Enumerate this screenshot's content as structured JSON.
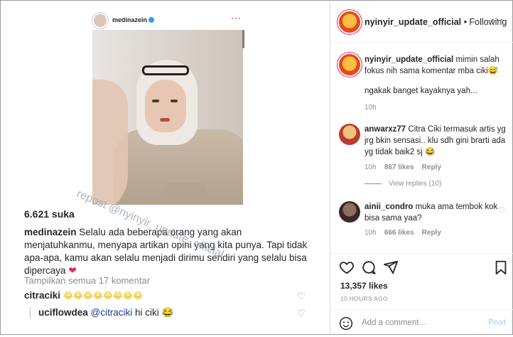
{
  "embedded_post": {
    "username": "medinazein",
    "likes": "6.621 suka",
    "caption_user": "medinazein",
    "caption_text": "Selalu ada beberapa orang yang akan menjatuhkanmu, menyapa artikan opini yang kita punya. Tapi tidak apa-apa, kamu akan selalu menjadi dirimu sendiri yang selalu bisa dipercaya",
    "view_comments": "Tampilkan semua 17 komentar",
    "comments": [
      {
        "user": "citraciki",
        "text": "😂😂😂😂😂😂😂😂"
      },
      {
        "user": "uciflowdea",
        "mention": "@citraciki",
        "text": "hi ciki 😂"
      }
    ],
    "watermark": "repost @nyinyir_update_official"
  },
  "sidebar": {
    "header": {
      "username": "nyinyir_update_official",
      "follow_status": "Following"
    },
    "comments": [
      {
        "user": "nyinyir_update_official",
        "text": "mimin salah fokus nih sama komentar mba ciki😅",
        "text2": "ngakak banget kayaknya yah...",
        "time": "10h"
      },
      {
        "user": "anwarxz77",
        "text": "Citra Ciki termasuk artis yg jrg bkin sensasi.. klu sdh gini brarti ada yg tidak baik2 sj 😂",
        "time": "10h",
        "likes": "867 likes",
        "reply": "Reply",
        "view_replies": "View replies (10)"
      },
      {
        "user": "ainii_condro",
        "text": "muka ama tembok kok bisa sama yaa?",
        "time": "10h",
        "likes": "666 likes",
        "reply": "Reply"
      }
    ],
    "likes": "13,357 likes",
    "time_ago": "10 HOURS AGO",
    "add_comment_placeholder": "Add a comment…",
    "post_button": "Post"
  },
  "colors": {
    "link_blue": "#3897f0",
    "post_disabled": "#b2dffc",
    "heart_red": "#e0245e"
  },
  "icons": [
    "heart-icon",
    "comment-icon",
    "share-icon",
    "bookmark-icon",
    "emoji-icon",
    "more-icon"
  ]
}
